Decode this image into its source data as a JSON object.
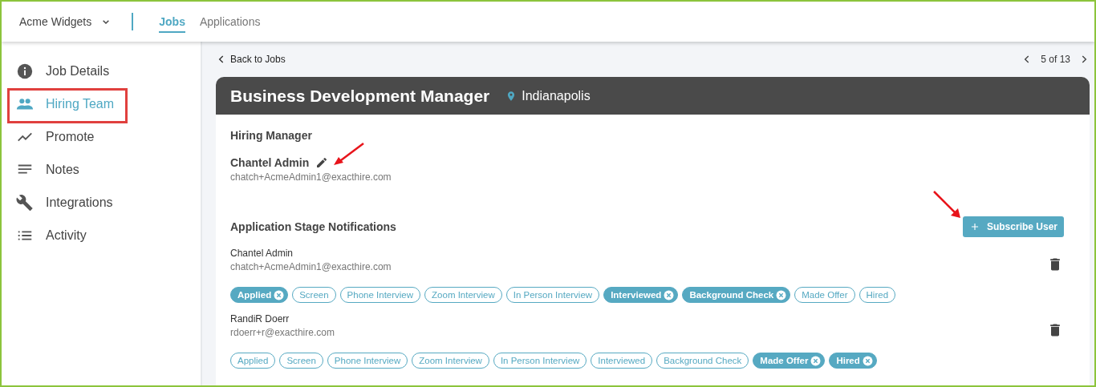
{
  "header": {
    "account": "Acme Widgets",
    "tabs": [
      {
        "label": "Jobs",
        "selected": true
      },
      {
        "label": "Applications",
        "selected": false
      }
    ]
  },
  "sidebar": {
    "items": [
      {
        "label": "Job Details",
        "kind": "info",
        "selected": false
      },
      {
        "label": "Hiring Team",
        "kind": "people",
        "selected": true
      },
      {
        "label": "Promote",
        "kind": "trend",
        "selected": false
      },
      {
        "label": "Notes",
        "kind": "notes",
        "selected": false
      },
      {
        "label": "Integrations",
        "kind": "wrench",
        "selected": false
      },
      {
        "label": "Activity",
        "kind": "list",
        "selected": false
      }
    ]
  },
  "nav": {
    "back": "Back to Jobs",
    "pager": "5 of 13"
  },
  "job": {
    "title": "Business Development Manager",
    "location": "Indianapolis"
  },
  "hiring_manager": {
    "heading": "Hiring Manager",
    "name": "Chantel Admin",
    "email": "chatch+AcmeAdmin1@exacthire.com"
  },
  "notifications": {
    "heading": "Application Stage Notifications",
    "button": "Subscribe User",
    "subscribers": [
      {
        "name": "Chantel Admin",
        "email": "chatch+AcmeAdmin1@exacthire.com",
        "stages": [
          {
            "label": "Applied",
            "selected": true
          },
          {
            "label": "Screen",
            "selected": false
          },
          {
            "label": "Phone Interview",
            "selected": false
          },
          {
            "label": "Zoom Interview",
            "selected": false
          },
          {
            "label": "In Person Interview",
            "selected": false
          },
          {
            "label": "Interviewed",
            "selected": true
          },
          {
            "label": "Background Check",
            "selected": true
          },
          {
            "label": "Made Offer",
            "selected": false
          },
          {
            "label": "Hired",
            "selected": false
          }
        ]
      },
      {
        "name": "RandiR Doerr",
        "email": "rdoerr+r@exacthire.com",
        "stages": [
          {
            "label": "Applied",
            "selected": false
          },
          {
            "label": "Screen",
            "selected": false
          },
          {
            "label": "Phone Interview",
            "selected": false
          },
          {
            "label": "Zoom Interview",
            "selected": false
          },
          {
            "label": "In Person Interview",
            "selected": false
          },
          {
            "label": "Interviewed",
            "selected": false
          },
          {
            "label": "Background Check",
            "selected": false
          },
          {
            "label": "Made Offer",
            "selected": true
          },
          {
            "label": "Hired",
            "selected": true
          }
        ]
      }
    ]
  }
}
